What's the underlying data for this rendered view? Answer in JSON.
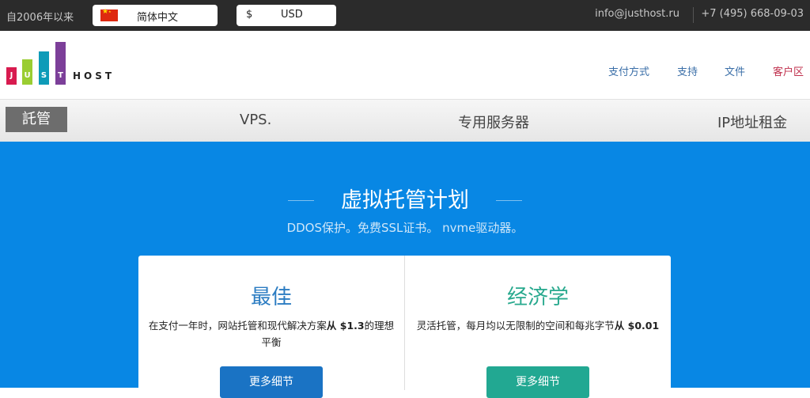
{
  "topbar": {
    "since": "自2006年以来",
    "language": "简体中文",
    "currency_symbol": "$",
    "currency": "USD",
    "email": "info@justhost.ru",
    "phone": "+7 (495) 668-09-03"
  },
  "logo": {
    "letters": [
      "J",
      "U",
      "S",
      "T"
    ],
    "host": "HOST",
    "colors": [
      "#d81b4f",
      "#9acd32",
      "#0e9bb8",
      "#7c3f99"
    ]
  },
  "header_nav": [
    "支付方式",
    "支持",
    "文件",
    "客户区"
  ],
  "menu": {
    "active": "託管",
    "items": [
      "VPS.",
      "专用服务器",
      "IP地址租金"
    ]
  },
  "hero": {
    "title": "虚拟托管计划",
    "subtitle": "DDOS保护。免费SSL证书。 nvme驱动器。"
  },
  "plans": [
    {
      "title": "最佳",
      "desc_plain": "在支付一年时，网站托管和现代解决方案",
      "desc_bold": "从 $1.3",
      "desc_tail": "的理想平衡",
      "button": "更多细节",
      "color": "#1a73c4"
    },
    {
      "title": "经济学",
      "desc_plain": "灵活托管，每月均以无限制的空间和每兆字节",
      "desc_bold": "从 $0.01",
      "desc_tail": "",
      "button": "更多细节",
      "color": "#22a892"
    }
  ]
}
